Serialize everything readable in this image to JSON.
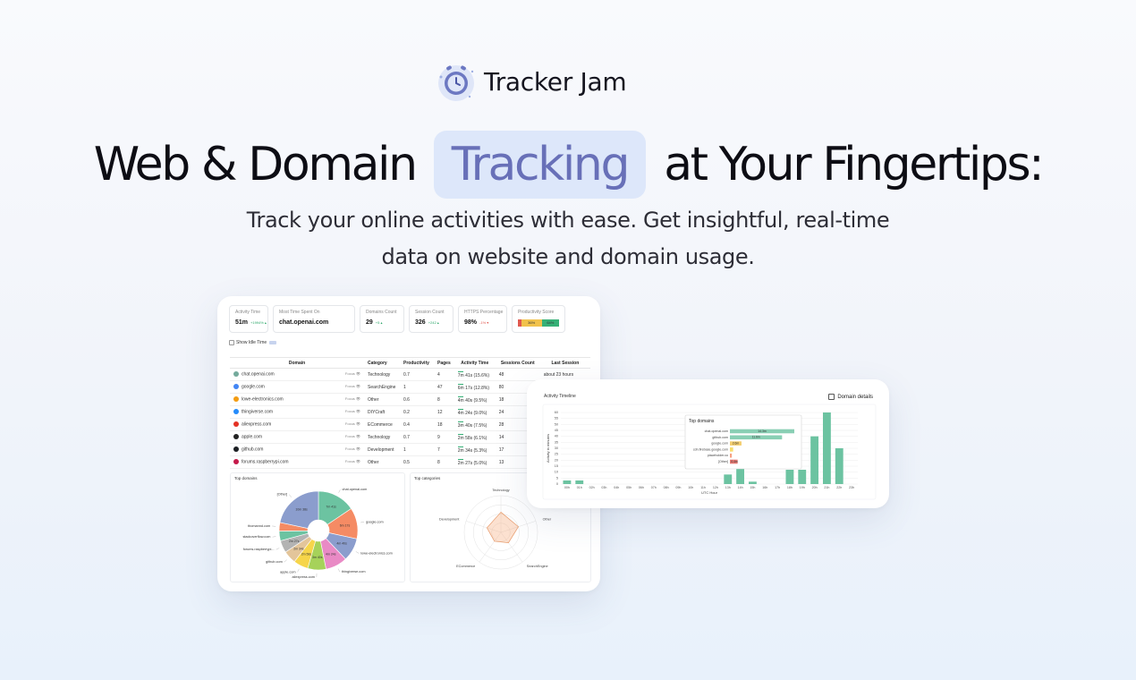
{
  "brand": {
    "name": "Tracker Jam"
  },
  "headline": {
    "before": "Web & Domain",
    "highlight": "Tracking",
    "after": "at Your Fingertips:"
  },
  "subheadline": {
    "line1": "Track your online activities with ease. Get insightful, real-time",
    "line2": "data on website and domain usage."
  },
  "stats": [
    {
      "label": "Activity Time",
      "value": "51m",
      "delta": "+1994% ▴",
      "delta_color": "#2ea86b"
    },
    {
      "label": "Most Time Spent On",
      "value": "chat.openai.com",
      "delta": ""
    },
    {
      "label": "Domains Count",
      "value": "29",
      "delta": "+5 ▴",
      "delta_color": "#2ea86b"
    },
    {
      "label": "Session Count",
      "value": "326",
      "delta": "+242 ▴",
      "delta_color": "#2ea86b"
    },
    {
      "label": "HTTPS Percentage",
      "value": "98%",
      "delta": "-1% ▾",
      "delta_color": "#e0584f"
    }
  ],
  "productivity": {
    "label": "Productivity Score",
    "segments": [
      {
        "text": "",
        "color": "#e0584f",
        "fraction": 0.08
      },
      {
        "text": "36%",
        "color": "#f1c24b",
        "fraction": 0.5
      },
      {
        "text": "64%",
        "color": "#35b076",
        "fraction": 0.42
      }
    ]
  },
  "idle_toggle": {
    "label": "Show Idle Time"
  },
  "table": {
    "headers": [
      "Domain",
      "Category",
      "Productivity",
      "Pages",
      "Activity Time",
      "Sessions Count",
      "Last Session"
    ],
    "focus_label": "Focus",
    "rows": [
      {
        "domain": "chat.openai.com",
        "icon_color": "#74aa9c",
        "category": "Technology",
        "productivity": "0.7",
        "pages": "4",
        "activity": "7m 41s (15.6%)",
        "sessions": "48",
        "last": "about 23 hours"
      },
      {
        "domain": "google.com",
        "icon_color": "#4285f4",
        "category": "SearchEngine",
        "productivity": "1",
        "pages": "47",
        "activity": "6m 17s (12.8%)",
        "sessions": "80",
        "last": ""
      },
      {
        "domain": "lowe-electronics.com",
        "icon_color": "#f39c12",
        "category": "Other",
        "productivity": "0.6",
        "pages": "8",
        "activity": "4m 40s (9.5%)",
        "sessions": "18",
        "last": ""
      },
      {
        "domain": "thingiverse.com",
        "icon_color": "#248bfb",
        "category": "DIYCraft",
        "productivity": "0.2",
        "pages": "12",
        "activity": "4m 24s (9.0%)",
        "sessions": "24",
        "last": ""
      },
      {
        "domain": "aliexpress.com",
        "icon_color": "#e43225",
        "category": "ECommerce",
        "productivity": "0.4",
        "pages": "18",
        "activity": "3m 40s (7.5%)",
        "sessions": "28",
        "last": ""
      },
      {
        "domain": "apple.com",
        "icon_color": "#222222",
        "category": "Technology",
        "productivity": "0.7",
        "pages": "9",
        "activity": "2m 58s (6.1%)",
        "sessions": "14",
        "last": ""
      },
      {
        "domain": "github.com",
        "icon_color": "#1b1f23",
        "category": "Development",
        "productivity": "1",
        "pages": "7",
        "activity": "2m 34s (5.3%)",
        "sessions": "17",
        "last": ""
      },
      {
        "domain": "forums.raspberrypi.com",
        "icon_color": "#c51a4a",
        "category": "Other",
        "productivity": "0.5",
        "pages": "8",
        "activity": "2m 27s (5.0%)",
        "sessions": "13",
        "last": ""
      }
    ]
  },
  "top_domains": {
    "title": "Top domains",
    "slices": [
      {
        "label": "chat.openai.com",
        "value": 15.6,
        "color": "#6cc3a1",
        "inner": "7m 41s"
      },
      {
        "label": "google.com",
        "value": 12.8,
        "color": "#f58b64",
        "inner": "6m 17s"
      },
      {
        "label": "lowe-electronics.com",
        "value": 9.5,
        "color": "#8b9dcd",
        "inner": "4m 40s"
      },
      {
        "label": "thingiverse.com",
        "value": 9.0,
        "color": "#e98ac5",
        "inner": "4m 24s"
      },
      {
        "label": "aliexpress.com",
        "value": 7.5,
        "color": "#a6d25a",
        "inner": "3m 40s"
      },
      {
        "label": "apple.com",
        "value": 6.1,
        "color": "#f6d54a",
        "inner": "2m 58s"
      },
      {
        "label": "github.com",
        "value": 5.3,
        "color": "#e3c59a",
        "inner": "2m 34s"
      },
      {
        "label": "forums.raspberrypi...",
        "value": 5.0,
        "color": "#b3b3b3",
        "inner": "2m 27s"
      },
      {
        "label": "stackoverflow.com",
        "value": 4.0,
        "color": "#6cc3a1",
        "inner": ""
      },
      {
        "label": "thomannd.com",
        "value": 3.5,
        "color": "#f58b64",
        "inner": ""
      },
      {
        "label": "[Other]",
        "value": 21.7,
        "color": "#8b9dcd",
        "inner": "10m 38s"
      }
    ]
  },
  "top_categories": {
    "title": "Top categories",
    "axes": [
      "Technology",
      "Other",
      "SearchEngine",
      "ECommerce",
      "Development"
    ],
    "values": [
      0.55,
      0.5,
      0.35,
      0.3,
      0.4
    ]
  },
  "timeline": {
    "title": "Activity Timeline",
    "details_label": "Domain details",
    "tooltip_title": "Top domains",
    "tooltip_rows": [
      {
        "domain": "chat.openai.com",
        "value": "14.3m",
        "fraction": 1.0,
        "color": "#6cc3a1"
      },
      {
        "domain": "github.com",
        "value": "11.6m",
        "fraction": 0.81,
        "color": "#6cc3a1"
      },
      {
        "domain": "google.com",
        "value": "2.6m",
        "fraction": 0.18,
        "color": "#f1c24b"
      },
      {
        "domain": "cdn.firebase.google.com",
        "value": "",
        "fraction": 0.05,
        "color": "#f6d54a"
      },
      {
        "domain": "placeholder.co",
        "value": "",
        "fraction": 0.03,
        "color": "#f58b64"
      },
      {
        "domain": "[Other]",
        "value": "0.4m",
        "fraction": 0.12,
        "color": "#e0584f"
      }
    ],
    "chart_data": {
      "type": "bar",
      "categories": [
        "00h",
        "01h",
        "02h",
        "03h",
        "04h",
        "05h",
        "06h",
        "07h",
        "08h",
        "09h",
        "10h",
        "11h",
        "12h",
        "13h",
        "14h",
        "15h",
        "16h",
        "17h",
        "18h",
        "19h",
        "20h",
        "21h",
        "22h",
        "23h"
      ],
      "values": [
        3,
        3,
        0,
        0,
        0,
        0,
        0,
        0,
        0,
        0,
        0,
        0,
        0,
        8,
        14,
        2,
        0,
        0,
        12,
        12,
        40,
        60,
        30,
        0
      ],
      "xlabel": "UTC Hour",
      "ylabel": "Activity in minutes",
      "ylim": [
        0,
        60
      ],
      "yticks": [
        0,
        5,
        10,
        15,
        20,
        25,
        30,
        35,
        40,
        45,
        50,
        55,
        60
      ],
      "color": "#6cc3a1"
    }
  }
}
